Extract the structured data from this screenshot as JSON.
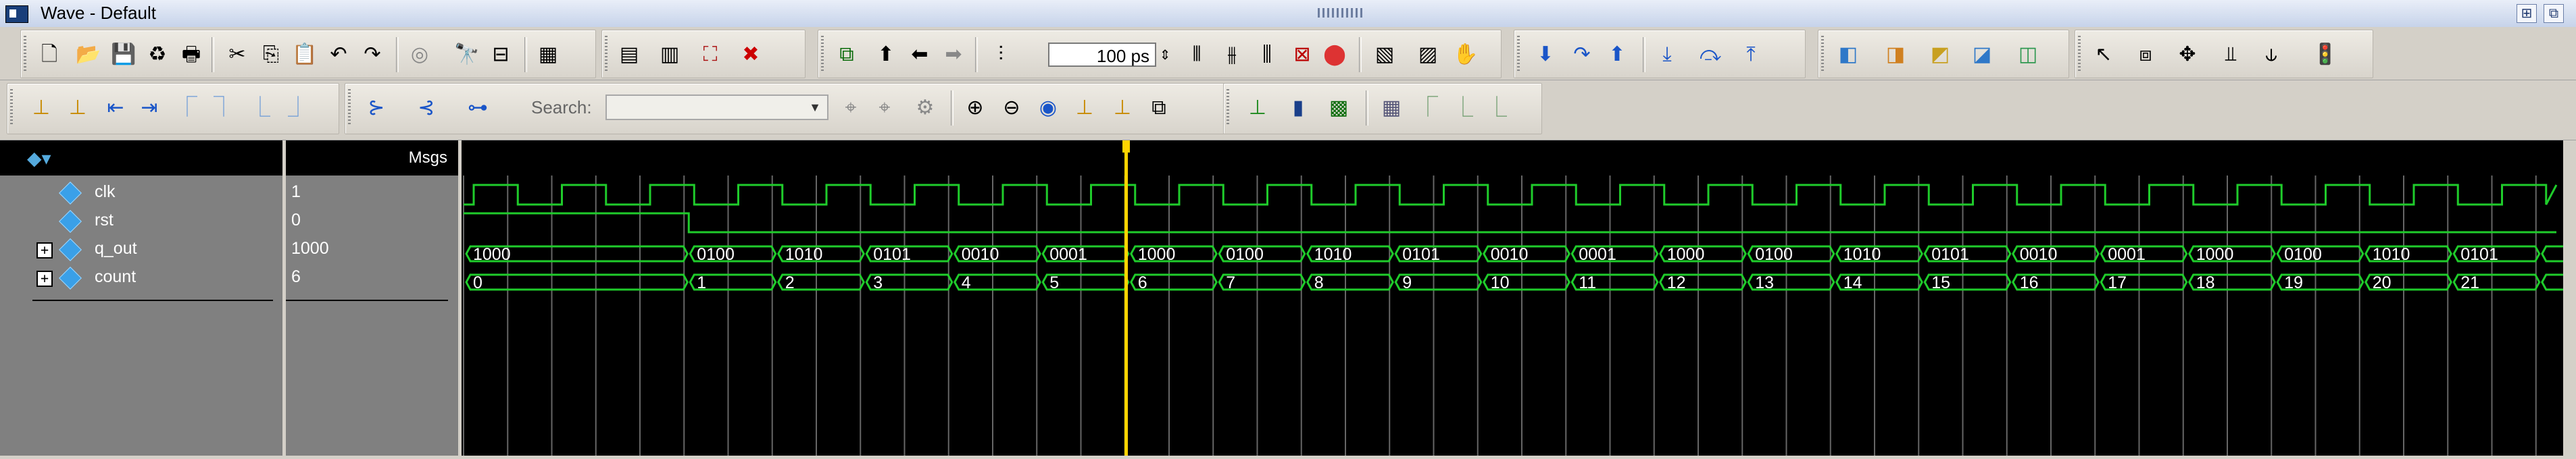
{
  "window": {
    "title": "Wave - Default",
    "colors": {
      "titlebar": "#c6d3ea",
      "wave_green": "#1fcc2b",
      "cursor": "#ffd400",
      "plot_bg": "#000000",
      "pane_bg": "#808080"
    }
  },
  "toolbar_row1": {
    "icons": [
      "new-file-icon",
      "open-folder-icon",
      "save-icon",
      "reload-icon",
      "print-icon",
      "cut-icon",
      "copy-icon",
      "paste-icon",
      "undo-icon",
      "redo-icon",
      "break-icon",
      "find-icon",
      "find-next-icon",
      "compile-icon",
      "compile-all-icon",
      "simulate-icon",
      "break-sim-icon",
      "stop-sim-icon",
      "add-wave-icon",
      "up-arrow-icon",
      "left-arrow-icon",
      "right-arrow-icon",
      "run-length-icon"
    ],
    "run_length": "100 ps",
    "icons2": [
      "run-icon",
      "continue-icon",
      "run-all-icon",
      "break-run-icon",
      "restart-icon",
      "wave-settings-icon",
      "zoom-region-icon",
      "hand-icon",
      "step-icon",
      "step-over-icon",
      "step-out-icon",
      "step-into-icon",
      "step-back-icon",
      "step-forward-icon",
      "layout-1-icon",
      "layout-2-icon",
      "layout-3-icon",
      "layout-4-icon",
      "layout-5-icon",
      "select-pointer-icon",
      "zoom-box-icon",
      "move-icon",
      "edge-icon",
      "sort-icon",
      "traffic-light-icon"
    ]
  },
  "toolbar_row2": {
    "icons": [
      "insert-cursor-icon",
      "delete-cursor-icon",
      "prev-edge-icon",
      "next-edge-icon",
      "prev-falling-icon",
      "next-falling-icon",
      "prev-rising-icon",
      "next-rising-icon",
      "expand-icon",
      "collapse-icon",
      "find-signal-icon"
    ],
    "search_label": "Search:",
    "search_placeholder": "",
    "icons2": [
      "search-prev-icon",
      "search-next-icon",
      "search-options-icon",
      "zoom-in-icon",
      "zoom-out-icon",
      "zoom-full-icon",
      "zoom-cursor-icon",
      "zoom-last-icon",
      "zoom-region-icon",
      "format-literal-icon",
      "format-logic-icon",
      "format-event-icon",
      "format-analog-icon",
      "format-step-icon",
      "format-interp-icon"
    ]
  },
  "panes": {
    "values_header": "Msgs"
  },
  "signals": [
    {
      "name": "clk",
      "value": "1",
      "expandable": false
    },
    {
      "name": "rst",
      "value": "0",
      "expandable": false
    },
    {
      "name": "q_out",
      "value": "1000",
      "expandable": true
    },
    {
      "name": "count",
      "value": "6",
      "expandable": true
    }
  ],
  "waveform": {
    "clock_cycles": 24.5,
    "rst_high_until_cycle": 2.5,
    "cursor_cycle": 7.5,
    "q_out_values": [
      "1000",
      "0100",
      "1010",
      "0101",
      "0010",
      "0001",
      "1000",
      "0100",
      "1010",
      "0101",
      "0010",
      "0001",
      "1000",
      "0100",
      "1010",
      "0101",
      "0010",
      "0001",
      "1000",
      "0100",
      "1010",
      "0101",
      ""
    ],
    "count_values": [
      "0",
      "1",
      "2",
      "3",
      "4",
      "5",
      "6",
      "7",
      "8",
      "9",
      "10",
      "11",
      "12",
      "13",
      "14",
      "15",
      "16",
      "17",
      "18",
      "19",
      "20",
      "21",
      ""
    ]
  }
}
